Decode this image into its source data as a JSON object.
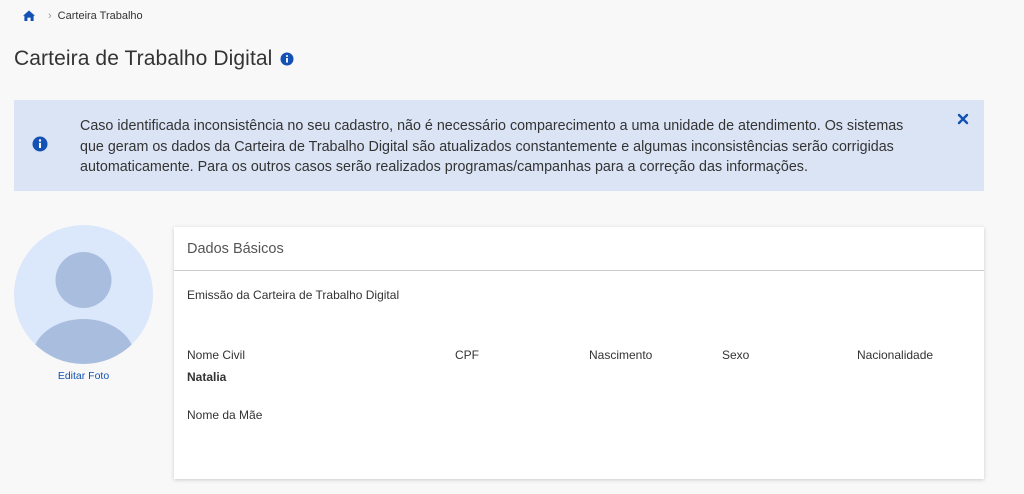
{
  "breadcrumb": {
    "home_icon": "home-icon",
    "current": "Carteira Trabalho"
  },
  "page": {
    "title": "Carteira de Trabalho Digital",
    "title_icon": "info-icon"
  },
  "alert": {
    "icon": "info-icon",
    "text": "Caso identificada inconsistência no seu cadastro, não é necessário comparecimento a uma unidade de atendimento. Os sistemas que geram os dados da Carteira de Trabalho Digital são atualizados constantemente e algumas inconsistências serão corrigidas automaticamente. Para os outros casos serão realizados programas/campanhas para a correção das informações.",
    "close_icon": "close-icon",
    "background": "#dbe4f5"
  },
  "profile": {
    "edit_photo_label": "Editar Foto"
  },
  "card": {
    "title": "Dados Básicos",
    "subtitle": "Emissão da Carteira de Trabalho Digital",
    "fields": {
      "nome_civil": {
        "label": "Nome Civil",
        "value": "Natalia"
      },
      "cpf": {
        "label": "CPF"
      },
      "nascimento": {
        "label": "Nascimento"
      },
      "sexo": {
        "label": "Sexo"
      },
      "nacionalidade": {
        "label": "Nacionalidade"
      },
      "nome_mae": {
        "label": "Nome da Mãe"
      }
    }
  },
  "colors": {
    "primary_blue": "#1351b4",
    "background": "#f8f8f8"
  }
}
